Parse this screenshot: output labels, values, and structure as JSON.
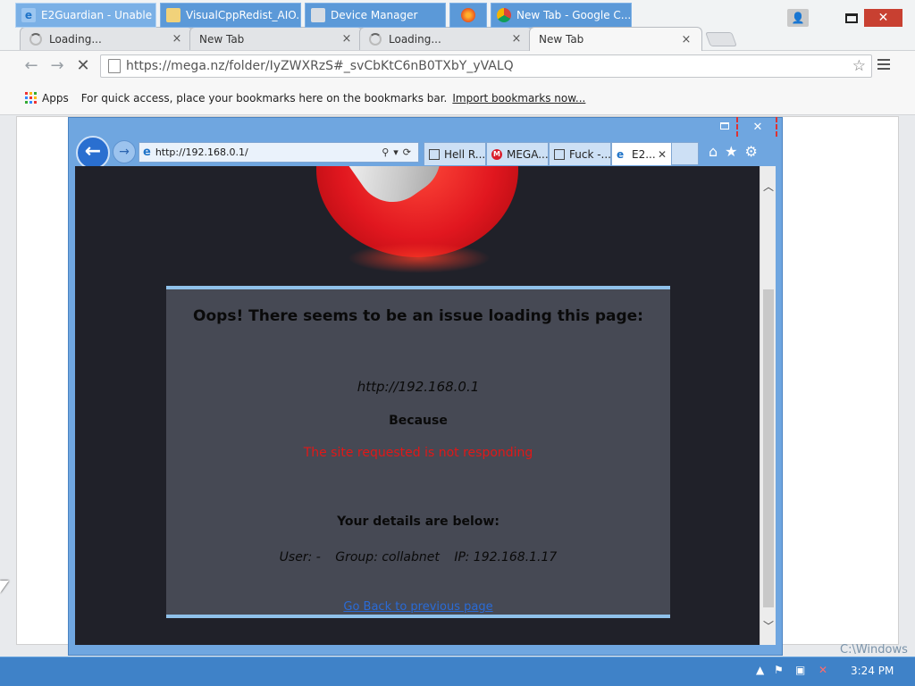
{
  "chrome": {
    "tabs": [
      {
        "title": "Loading...",
        "loading": true
      },
      {
        "title": "New Tab",
        "loading": false
      },
      {
        "title": "Loading...",
        "loading": true
      },
      {
        "title": "New Tab",
        "loading": false,
        "active": true
      }
    ],
    "tab_close": "×",
    "window_close": "✕",
    "url": "https://mega.nz/folder/IyZWXRzS#_svCbKtC6nB0TXbY_yVALQ",
    "bookmarks": {
      "apps_label": "Apps",
      "hint": "For quick access, place your bookmarks here on the bookmarks bar.",
      "import_link": "Import bookmarks now..."
    }
  },
  "ie": {
    "url": "http://192.168.0.1/",
    "tabs": [
      {
        "title": "Hell R..."
      },
      {
        "title": "MEGA..."
      },
      {
        "title": "Fuck -..."
      },
      {
        "title": "E2...",
        "active": true
      }
    ],
    "close_label": "✕"
  },
  "error_page": {
    "title": "Oops! There seems to be an issue loading this page:",
    "url": "http://192.168.0.1",
    "because": "Because",
    "reason": "The site requested is not responding",
    "details_title": "Your details are below:",
    "user": "User: -",
    "group": "Group: collabnet",
    "ip": "IP: 192.168.1.17",
    "back_link": "Go Back to previous page"
  },
  "taskbar": {
    "items": [
      {
        "label": "E2Guardian - Unable ...",
        "active": true
      },
      {
        "label": "VisualCppRedist_AIO..."
      },
      {
        "label": "Device Manager"
      },
      {
        "label": ""
      },
      {
        "label": "New Tab - Google C..."
      }
    ],
    "clock": "3:24 PM"
  },
  "desktop": {
    "text": "C:\\Windows"
  },
  "colors": {
    "taskbar": "#3f82c8",
    "error_red": "#e01818",
    "ie_frame": "#6fa6e0",
    "mega_red": "#e1171f"
  }
}
